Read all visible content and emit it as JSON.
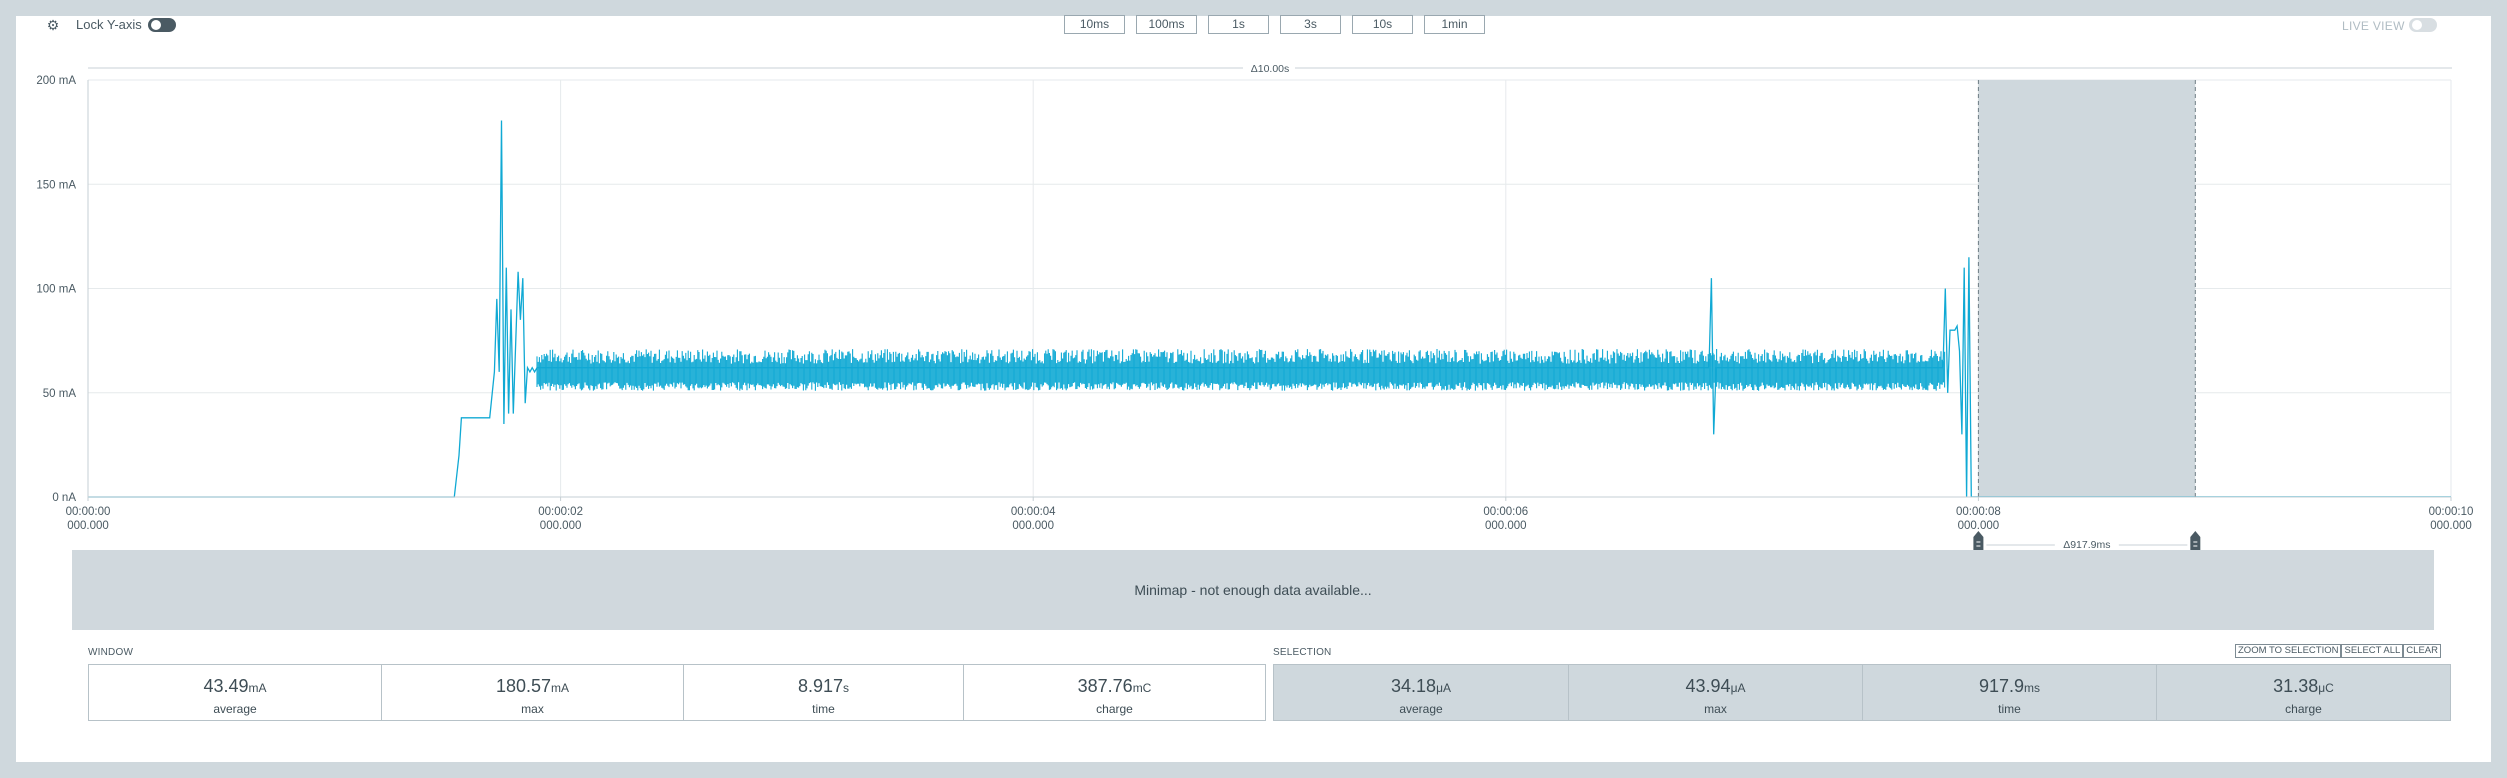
{
  "toolbar": {
    "settings_icon": "gear-icon",
    "lock_y_axis_label": "Lock Y-axis",
    "lock_y_axis_on": true,
    "zoom_buttons": [
      "10ms",
      "100ms",
      "1s",
      "3s",
      "10s",
      "1min"
    ],
    "live_view_label": "LIVE VIEW",
    "live_view_on": false
  },
  "chart": {
    "window_delta": "Δ10.00s",
    "selection_delta": "Δ917.9ms",
    "y_ticks": [
      "200 mA",
      "150 mA",
      "100 mA",
      "50 mA",
      "0 nA"
    ],
    "x_ticks": [
      {
        "time": "00:00:00",
        "ms": "000.000"
      },
      {
        "time": "00:00:02",
        "ms": "000.000"
      },
      {
        "time": "00:00:04",
        "ms": "000.000"
      },
      {
        "time": "00:00:06",
        "ms": "000.000"
      },
      {
        "time": "00:00:08",
        "ms": "000.000"
      },
      {
        "time": "00:00:10",
        "ms": "000.000"
      }
    ],
    "series_color": "#10a9d4",
    "selection_range_s": [
      8.0,
      8.918
    ]
  },
  "chart_data": {
    "type": "line",
    "xlabel": "",
    "ylabel": "",
    "xlim": [
      0,
      10
    ],
    "ylim": [
      0,
      200
    ],
    "grid": true,
    "series": [
      {
        "x": [
          0,
          1.55,
          1.57,
          1.58,
          1.6,
          1.62,
          1.7,
          1.72,
          1.73,
          1.74,
          1.75,
          1.76,
          1.77,
          1.78,
          1.79,
          1.8,
          1.82,
          1.83,
          1.84,
          1.85,
          1.86,
          1.87,
          1.88,
          1.89,
          1.9,
          2.5,
          3.0,
          3.5,
          4.0,
          4.5,
          5.0,
          5.5,
          6.0,
          6.5,
          6.86,
          6.87,
          6.88,
          6.89,
          6.9,
          7.3,
          7.8,
          7.85,
          7.86,
          7.87,
          7.88,
          7.9,
          7.91,
          7.92,
          7.93,
          7.94,
          7.95,
          7.96,
          7.97,
          7.98,
          10.0
        ],
        "y": [
          0,
          0,
          20,
          38,
          38,
          38,
          38,
          60,
          95,
          60,
          180.57,
          35,
          110,
          40,
          90,
          40,
          108,
          85,
          105,
          45,
          62,
          60,
          62,
          60,
          62,
          62,
          62,
          62,
          62,
          62,
          62,
          62,
          62,
          62,
          62,
          105,
          30,
          62,
          62,
          62,
          62,
          62,
          100,
          50,
          80,
          80,
          82,
          70,
          30,
          110,
          0,
          115,
          0.03,
          0.03,
          0.03
        ]
      }
    ]
  },
  "minimap": {
    "message": "Minimap - not enough data available..."
  },
  "window_stats": {
    "label": "WINDOW",
    "items": [
      {
        "value": "43.49",
        "unit": "mA",
        "name": "average"
      },
      {
        "value": "180.57",
        "unit": "mA",
        "name": "max"
      },
      {
        "value": "8.917",
        "unit": "s",
        "name": "time"
      },
      {
        "value": "387.76",
        "unit": "mC",
        "name": "charge"
      }
    ]
  },
  "selection_stats": {
    "label": "SELECTION",
    "actions": [
      "ZOOM TO SELECTION",
      "SELECT ALL",
      "CLEAR"
    ],
    "items": [
      {
        "value": "34.18",
        "unit": "μA",
        "name": "average"
      },
      {
        "value": "43.94",
        "unit": "μA",
        "name": "max"
      },
      {
        "value": "917.9",
        "unit": "ms",
        "name": "time"
      },
      {
        "value": "31.38",
        "unit": "μC",
        "name": "charge"
      }
    ]
  }
}
